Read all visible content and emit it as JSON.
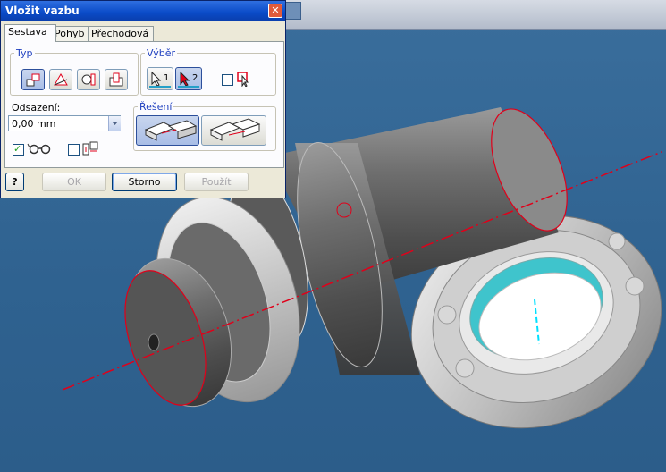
{
  "dialog": {
    "title": "Vložit vazbu",
    "close_glyph": "✕",
    "tabs": [
      {
        "label": "Sestava",
        "active": true
      },
      {
        "label": "Pohyb",
        "active": false
      },
      {
        "label": "Přechodová",
        "active": false
      }
    ],
    "type_group": {
      "legend": "Typ",
      "icons": [
        "mate-icon",
        "angle-icon",
        "tangent-icon",
        "insert-icon"
      ],
      "selected": 0
    },
    "selection_group": {
      "legend": "Výběr",
      "first_label": "1",
      "second_label": "2",
      "first_select_icon": "arrow-select-1-icon",
      "second_select_icon": "arrow-select-2-icon",
      "pick_part_checked": false,
      "pick_part_icon": "pick-part-first-icon"
    },
    "offset": {
      "label": "Odsazení:",
      "value": "0,00 mm"
    },
    "solution_group": {
      "legend": "Řešení",
      "options": [
        "mate-solution-icon",
        "flush-solution-icon"
      ],
      "selected": 0
    },
    "preview_checked": true,
    "preview_icon": "glasses-icon",
    "predict_offset_checked": false,
    "predict_offset_icon": "predict-offset-icon",
    "buttons": {
      "help_glyph": "?",
      "ok": "OK",
      "cancel": "Storno",
      "apply": "Použít"
    },
    "colors": {
      "title_bar": "#0a4bc8",
      "accent_red": "#e0001a",
      "selected_bg": "#a8bde6"
    }
  }
}
